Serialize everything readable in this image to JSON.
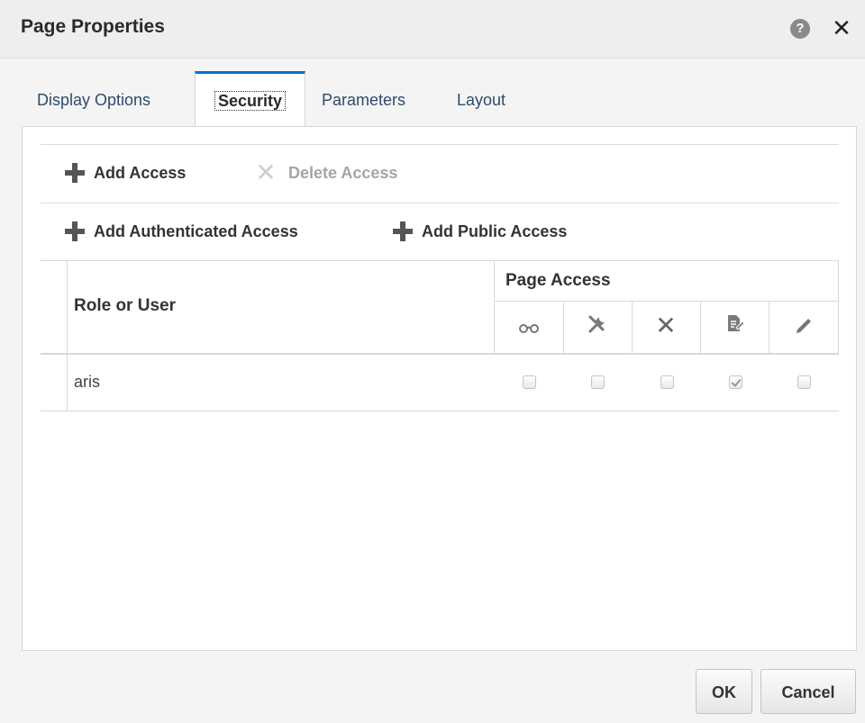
{
  "dialog": {
    "title": "Page Properties",
    "help_icon": "help-icon",
    "close_icon": "close-icon"
  },
  "tabs": [
    {
      "label": "Display Options",
      "active": false
    },
    {
      "label": "Security",
      "active": true
    },
    {
      "label": "Parameters",
      "active": false
    },
    {
      "label": "Layout",
      "active": false
    }
  ],
  "toolbar": {
    "add_access": "Add Access",
    "delete_access": "Delete Access",
    "add_authenticated_access": "Add Authenticated Access",
    "add_public_access": "Add Public Access"
  },
  "table": {
    "role_header": "Role or User",
    "page_access_header": "Page Access",
    "permission_icons": [
      "view-icon",
      "customize-icon",
      "delete-icon",
      "edit-content-icon",
      "edit-icon"
    ],
    "rows": [
      {
        "role": "aris",
        "permissions": [
          false,
          false,
          false,
          true,
          false
        ]
      }
    ]
  },
  "footer": {
    "ok_label": "OK",
    "cancel_label": "Cancel"
  },
  "colors": {
    "active_tab_accent": "#0572ce",
    "tab_text": "#2d4b6b"
  }
}
